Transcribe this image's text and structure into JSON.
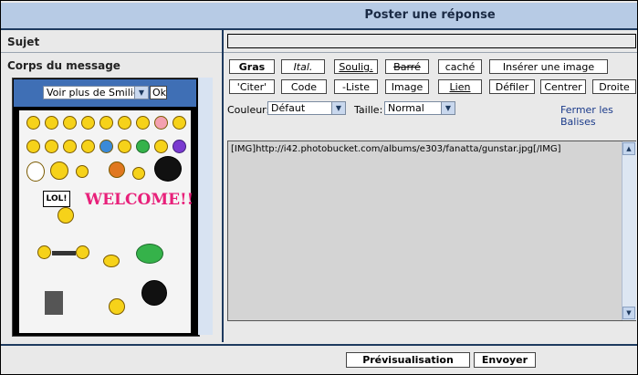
{
  "header": {
    "title": "Poster une réponse"
  },
  "labels": {
    "subject": "Sujet",
    "body": "Corps du message"
  },
  "subject": {
    "value": ""
  },
  "smilies": {
    "select_value": "Voir plus de Smilies",
    "ok_label": "Ok",
    "banner": "WELCOME!!",
    "lol": "LOL!"
  },
  "toolbar": {
    "row1": [
      "Gras",
      "Ital.",
      "Soulig.",
      "Barré",
      "caché",
      "Insérer une image"
    ],
    "row2": [
      "'Citer'",
      "Code",
      "-Liste",
      "Image",
      "Lien",
      "Défiler",
      "Centrer",
      "Droite"
    ]
  },
  "options": {
    "color_label": "Couleur:",
    "color_value": "Défaut",
    "size_label": "Taille:",
    "size_value": "Normal",
    "close_tags": "Fermer les Balises"
  },
  "message": {
    "value": "[IMG]http://i42.photobucket.com/albums/e303/fanatta/gunstar.jpg[/IMG]"
  },
  "actions": {
    "preview": "Prévisualisation",
    "send": "Envoyer"
  }
}
